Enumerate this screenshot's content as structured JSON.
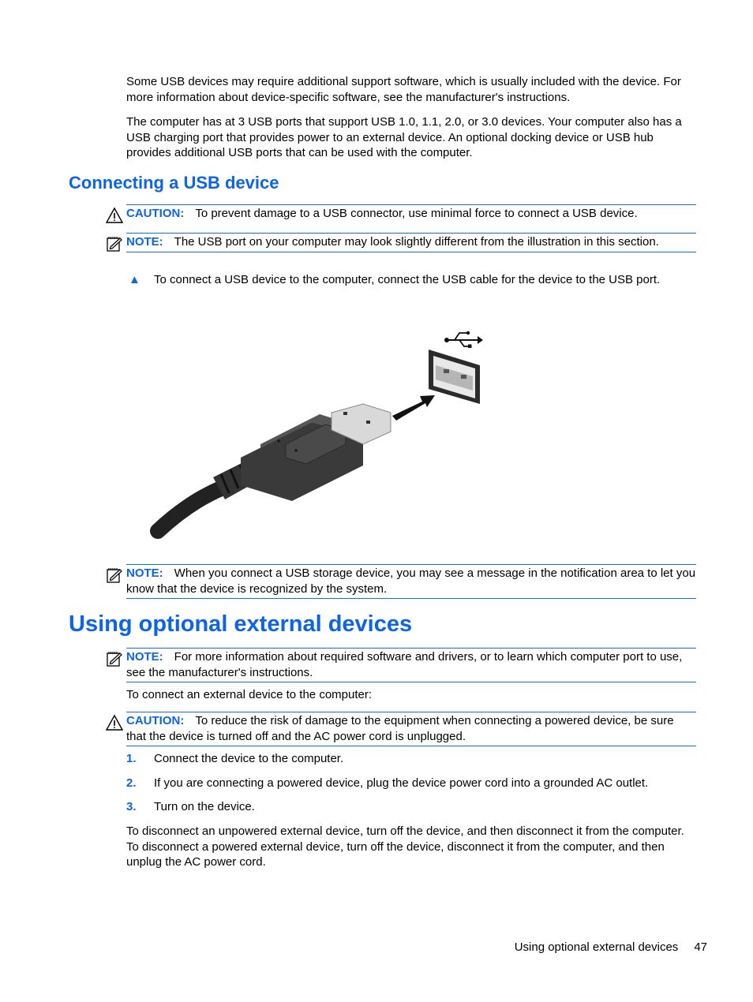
{
  "intro": {
    "para1": "Some USB devices may require additional support software, which is usually included with the device. For more information about device-specific software, see the manufacturer's instructions.",
    "para2": "The computer has at 3 USB ports that support USB 1.0, 1.1, 2.0, or 3.0 devices. Your computer also has a USB charging port that provides power to an external device. An optional docking device or USB hub provides additional USB ports that can be used with the computer."
  },
  "section1": {
    "heading": "Connecting a USB device",
    "caution": {
      "label": "CAUTION:",
      "text": "To prevent damage to a USB connector, use minimal force to connect a USB device."
    },
    "note1": {
      "label": "NOTE:",
      "text": "The USB port on your computer may look slightly different from the illustration in this section."
    },
    "step": {
      "bullet": "▲",
      "text": "To connect a USB device to the computer, connect the USB cable for the device to the USB port."
    },
    "figure": {
      "description": "USB cable plug being inserted into USB port, with USB symbol"
    },
    "note2": {
      "label": "NOTE:",
      "text": "When you connect a USB storage device, you may see a message in the notification area to let you know that the device is recognized by the system."
    }
  },
  "section2": {
    "heading": "Using optional external devices",
    "note": {
      "label": "NOTE:",
      "text": "For more information about required software and drivers, or to learn which computer port to use, see the manufacturer's instructions."
    },
    "intro": "To connect an external device to the computer:",
    "caution": {
      "label": "CAUTION:",
      "text": "To reduce the risk of damage to the equipment when connecting a powered device, be sure that the device is turned off and the AC power cord is unplugged."
    },
    "steps": [
      {
        "num": "1.",
        "text": "Connect the device to the computer."
      },
      {
        "num": "2.",
        "text": "If you are connecting a powered device, plug the device power cord into a grounded AC outlet."
      },
      {
        "num": "3.",
        "text": "Turn on the device."
      }
    ],
    "closing": "To disconnect an unpowered external device, turn off the device, and then disconnect it from the computer. To disconnect a powered external device, turn off the device, disconnect it from the computer, and then unplug the AC power cord."
  },
  "footer": {
    "title": "Using optional external devices",
    "page": "47"
  },
  "colors": {
    "accent": "#0c64e6"
  }
}
